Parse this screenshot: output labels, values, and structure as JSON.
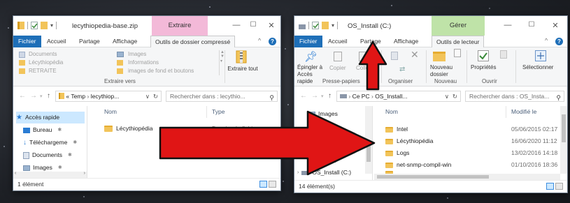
{
  "left_window": {
    "title": "lecythiopedia-base.zip",
    "context_tab_header": "Extraire",
    "tabs": [
      "Fichier",
      "Accueil",
      "Partage",
      "Affichage",
      "Outils de dossier compressé"
    ],
    "ribbon": {
      "locations_col1": [
        "Documents",
        "Lécythiopédia",
        "RETRAITE"
      ],
      "locations_col2": [
        "Images",
        "Informations",
        "images de fond et boutons"
      ],
      "extract_all": "Extraire tout",
      "group_label": "Extraire vers"
    },
    "address": {
      "path_prefix": "«",
      "segments": [
        "Temp",
        "lecythiop..."
      ],
      "search_placeholder": "Rechercher dans : lecythio..."
    },
    "nav_items": [
      {
        "label": "Accès rapide",
        "icon": "star-icon"
      },
      {
        "label": "Bureau",
        "icon": "desktop-icon"
      },
      {
        "label": "Téléchargeme",
        "icon": "download-icon"
      },
      {
        "label": "Documents",
        "icon": "documents-icon"
      },
      {
        "label": "Images",
        "icon": "images-icon"
      }
    ],
    "columns": {
      "name": "Nom",
      "type": "Type"
    },
    "files": [
      {
        "name": "Lécythiopédia",
        "type": "Dossier de fichiers"
      }
    ],
    "status": "1 élément"
  },
  "right_window": {
    "title": "OS_Install (C:)",
    "context_tab_header": "Gérer",
    "tabs": [
      "Fichier",
      "Accueil",
      "Partage",
      "Affichage",
      "Outils de lecteur"
    ],
    "ribbon": {
      "pin_label": "Épingler à Accès rapide",
      "copy_label": "Copier",
      "paste_label": "Coller",
      "new_folder_label": "Nouveau dossier",
      "properties_label": "Propriétés",
      "select_label": "Sélectionner",
      "groups": [
        "Presse-papiers",
        "Organiser",
        "Nouveau",
        "Ouvrir"
      ]
    },
    "address": {
      "segments": [
        "Ce PC",
        "OS_Install..."
      ],
      "search_placeholder": "Rechercher dans : OS_Insta..."
    },
    "nav_items": [
      {
        "label": "Images",
        "icon": "images-icon"
      },
      {
        "label": "Musique",
        "icon": "music-icon"
      },
      {
        "label": "Téléchargements",
        "icon": "download-icon"
      },
      {
        "label": "Vidéos",
        "icon": "videos-icon"
      },
      {
        "label": "OS_Install (C:)",
        "icon": "drive-icon"
      }
    ],
    "columns": {
      "name": "Nom",
      "modified": "Modifié le"
    },
    "files": [
      {
        "name": "Intel",
        "date": "05/06/2015 02:17"
      },
      {
        "name": "Lécythiopédia",
        "date": "16/06/2020 11:12"
      },
      {
        "name": "Logs",
        "date": "13/02/2016 14:18"
      },
      {
        "name": "net-snmp-compil-win",
        "date": "01/10/2016 18:36"
      }
    ],
    "status": "14 élément(s)"
  },
  "colors": {
    "arrow_red": "#e01515",
    "file_tab_blue": "#1e6fb8",
    "selection_blue": "#cce8ff",
    "context_header_zip": "#f3b9d8",
    "context_header_drive": "#bfe3a8",
    "folder_yellow": "#f2c45a"
  }
}
